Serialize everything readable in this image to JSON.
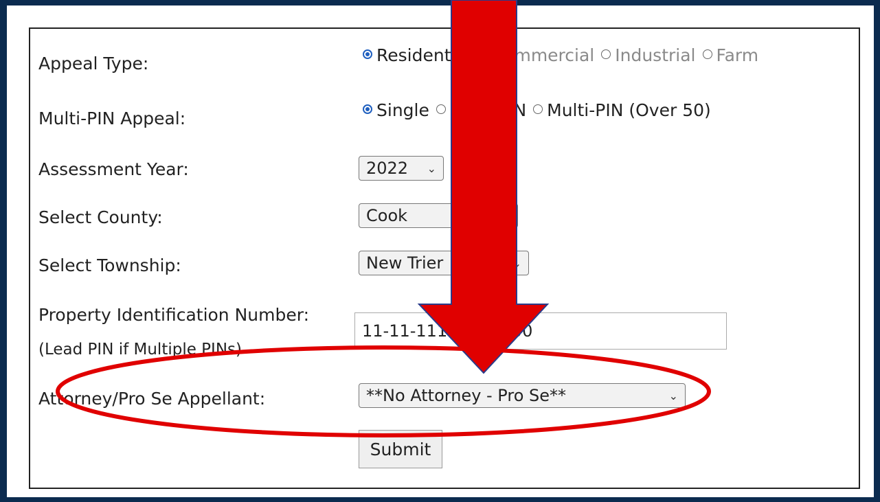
{
  "form": {
    "appeal_type": {
      "label": "Appeal Type:",
      "options": [
        {
          "label": "Residential",
          "checked": true
        },
        {
          "label": "Commercial",
          "checked": false
        },
        {
          "label": "Industrial",
          "checked": false
        },
        {
          "label": "Farm",
          "checked": false
        }
      ]
    },
    "multi_pin": {
      "label": "Multi-PIN Appeal:",
      "options": [
        {
          "label": "Single",
          "checked": true
        },
        {
          "label": "Multi-PIN",
          "checked": false
        },
        {
          "label": "Multi-PIN (Over 50)",
          "checked": false
        }
      ]
    },
    "assessment_year": {
      "label": "Assessment Year:",
      "value": "2022"
    },
    "county": {
      "label": "Select County:",
      "value": "Cook"
    },
    "township": {
      "label": "Select Township:",
      "value": "New Trier"
    },
    "pin": {
      "label": "Property Identification Number:",
      "sublabel": "(Lead PIN if Multiple PINs)",
      "value": "11-11-111-111-0000"
    },
    "attorney": {
      "label": "Attorney/Pro Se Appellant:",
      "value": "**No Attorney - Pro Se**"
    },
    "submit_label": "Submit"
  },
  "annotation": {
    "arrow_color": "#e00000",
    "ellipse_color": "#e00000"
  }
}
